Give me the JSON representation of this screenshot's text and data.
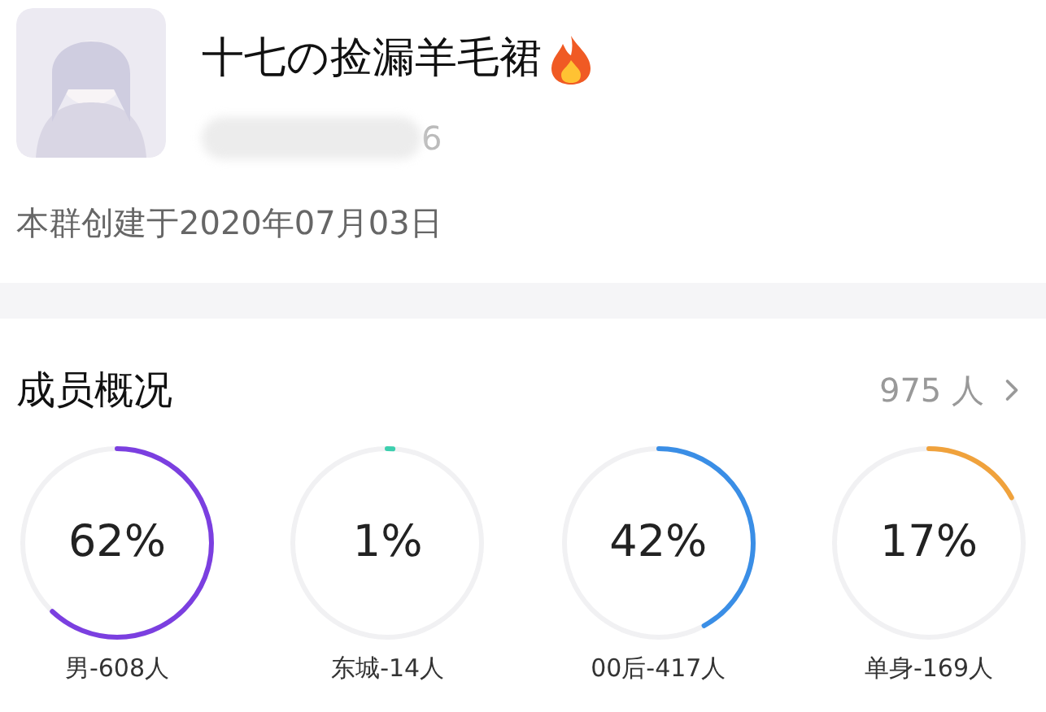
{
  "group": {
    "name": "十七の捡漏羊毛裙",
    "id_tail": "6",
    "created": "本群创建于2020年07月03日"
  },
  "members": {
    "title": "成员概况",
    "count": "975 人",
    "stats": [
      {
        "percent": "62%",
        "level": 0.62,
        "color": "#7b3fe0",
        "label": "男-608人"
      },
      {
        "percent": "1%",
        "level": 0.01,
        "color": "#3ccfae",
        "label": "东城-14人"
      },
      {
        "percent": "42%",
        "level": 0.42,
        "color": "#3a8ee6",
        "label": "00后-417人"
      },
      {
        "percent": "17%",
        "level": 0.17,
        "color": "#f0a23c",
        "label": "单身-169人"
      }
    ]
  }
}
